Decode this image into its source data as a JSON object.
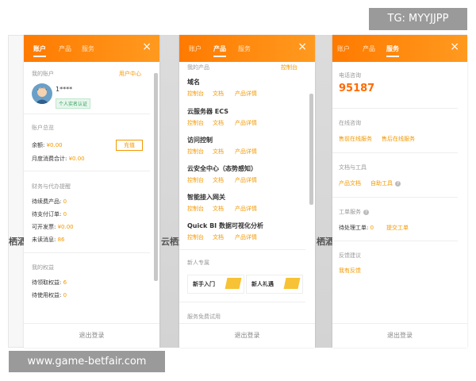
{
  "watermark_top": "TG: MYYJJPP",
  "watermark_bottom": "www.game-betfair.com",
  "background_peek": [
    "栖酒",
    "云栖酒",
    "栖酒"
  ],
  "colors": {
    "accent": "#ff7a00",
    "link": "#f39800",
    "footer_text": "#888888"
  },
  "panel_account": {
    "tabs": [
      "账户",
      "产品",
      "服务"
    ],
    "active_tab": "账户",
    "close_icon": "×",
    "my_account_label": "我的账户",
    "user_center_link": "用户中心",
    "username": "1****",
    "verified_badge": "个人实名认证",
    "overview_label": "账户总览",
    "balance_label": "余额:",
    "balance_value": "¥0.00",
    "recharge_button": "充值",
    "monthly_label": "月度消费合计:",
    "monthly_value": "¥0.00",
    "finance_label": "财务与代办提醒",
    "renew_label": "待续费产品:",
    "renew_value": "0",
    "unpaid_label": "待支付订单:",
    "unpaid_value": "0",
    "invoice_label": "可开发票:",
    "invoice_value": "¥0.00",
    "unread_label": "未读消息:",
    "unread_value": "86",
    "rights_label": "我的权益",
    "claim_label": "待领取权益:",
    "claim_value": "6",
    "use_label": "待使用权益:",
    "use_value": "0",
    "logout": "退出登录"
  },
  "panel_products": {
    "tabs": [
      "账户",
      "产品",
      "服务"
    ],
    "active_tab": "产品",
    "close_icon": "×",
    "my_products_label": "我的产品",
    "console_link": "控制台",
    "link_labels": [
      "控制台",
      "文档",
      "产品详情"
    ],
    "products": [
      "域名",
      "云服务器 ECS",
      "访问控制",
      "云安全中心（态势感知）",
      "智能接入网关",
      "Quick BI 数据可视化分析"
    ],
    "newcomer_label": "新人专属",
    "promo_1": "新手入门",
    "promo_2": "新人礼遇",
    "trial_label": "服务免费试用",
    "logout": "退出登录"
  },
  "panel_services": {
    "tabs": [
      "账户",
      "产品",
      "服务"
    ],
    "active_tab": "服务",
    "close_icon": "×",
    "phone_label": "电话咨询",
    "phone_number": "95187",
    "online_label": "在线咨询",
    "presale_link": "售前在线服务",
    "aftersale_link": "售后在线服务",
    "docs_label": "文档与工具",
    "docs_link": "产品文档",
    "tools_link": "自助工具",
    "ticket_label": "工单服务",
    "pending_label": "待处理工单:",
    "pending_value": "0",
    "submit_link": "提交工单",
    "feedback_label": "反馈建议",
    "feedback_link": "我有反馈",
    "logout": "退出登录"
  }
}
